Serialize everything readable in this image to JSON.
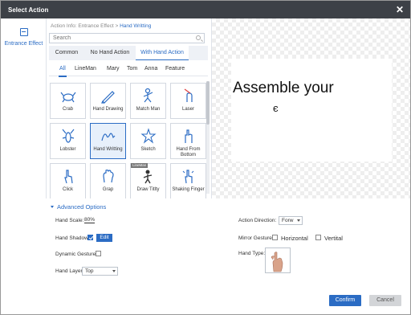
{
  "dialog": {
    "title": "Select Action"
  },
  "left_nav": {
    "items": [
      {
        "label": "Entrance Effect",
        "icon": "entrance-effect-icon"
      }
    ]
  },
  "breadcrumb": {
    "path": "Action Info: Entrance Effect >",
    "current": "Hand Writting"
  },
  "search": {
    "placeholder": "Search",
    "value": ""
  },
  "category_tabs": [
    {
      "label": "Common",
      "active": false
    },
    {
      "label": "No Hand Action",
      "active": false
    },
    {
      "label": "With Hand Action",
      "active": true
    }
  ],
  "sub_tabs": [
    {
      "label": "All",
      "active": true
    },
    {
      "label": "LineMan",
      "active": false
    },
    {
      "label": "Mary",
      "active": false
    },
    {
      "label": "Tom",
      "active": false
    },
    {
      "label": "Anna",
      "active": false
    },
    {
      "label": "Feature",
      "active": false
    }
  ],
  "actions": [
    {
      "label": "Crab",
      "icon": "crab-icon",
      "selected": false,
      "badge": ""
    },
    {
      "label": "Hand Drawing",
      "icon": "pencil-icon",
      "selected": false,
      "badge": ""
    },
    {
      "label": "Match Man",
      "icon": "match-man-icon",
      "selected": false,
      "badge": ""
    },
    {
      "label": "Laser",
      "icon": "laser-icon",
      "selected": false,
      "badge": ""
    },
    {
      "label": "Lobster",
      "icon": "lobster-icon",
      "selected": false,
      "badge": ""
    },
    {
      "label": "Hand Writting",
      "icon": "handwriting-icon",
      "selected": true,
      "badge": ""
    },
    {
      "label": "Sketch",
      "icon": "sketch-icon",
      "selected": false,
      "badge": ""
    },
    {
      "label": "Hand From Bottom",
      "icon": "hand-up-icon",
      "selected": false,
      "badge": ""
    },
    {
      "label": "Click",
      "icon": "click-hand-icon",
      "selected": false,
      "badge": ""
    },
    {
      "label": "Grap",
      "icon": "grab-hand-icon",
      "selected": false,
      "badge": ""
    },
    {
      "label": "Draw Titlty",
      "icon": "draw-figure-icon",
      "selected": false,
      "badge": "LineMan"
    },
    {
      "label": "Shaking Finger",
      "icon": "shaking-finger-icon",
      "selected": false,
      "badge": ""
    }
  ],
  "preview": {
    "text": "Assemble your",
    "fragment": "є"
  },
  "advanced": {
    "title": "Advanced Options",
    "hand_scale_label": "Hand Scale:",
    "hand_scale_value": "80%",
    "hand_shadow_label": "Hand Shadow",
    "hand_shadow_checked": true,
    "edit_label": "Edit",
    "dynamic_gesture_label": "Dynamic Gesture",
    "dynamic_gesture_checked": false,
    "hand_layer_label": "Hand Layer",
    "hand_layer_value": "Top",
    "action_direction_label": "Action Direction:",
    "action_direction_value": "Forw",
    "mirror_gesture_label": "Mirror Gesture",
    "horizontal_label": "Horizontal",
    "horizontal_checked": false,
    "vertical_label": "Vertital",
    "vertical_checked": false,
    "hand_type_label": "Hand Type:"
  },
  "footer": {
    "confirm_label": "Confirm",
    "cancel_label": "Cancel"
  },
  "colors": {
    "accent": "#2b6cc4",
    "titlebar": "#3d4147",
    "selected_bg": "#e7f0fb"
  }
}
